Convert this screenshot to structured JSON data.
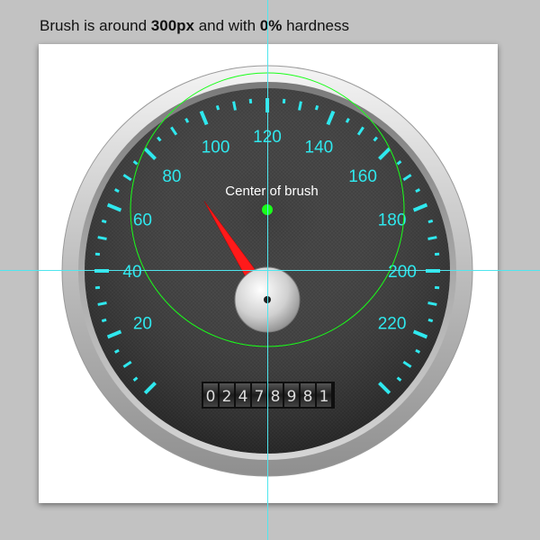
{
  "caption": {
    "prefix": "Brush is around ",
    "size_value": "300px",
    "middle": " and with ",
    "hardness_value": "0%",
    "suffix": " hardness"
  },
  "gauge": {
    "scale_labels": [
      "20",
      "40",
      "60",
      "80",
      "100",
      "120",
      "140",
      "160",
      "180",
      "200",
      "220"
    ],
    "needle_value": 91,
    "brush_center_label": "Center of brush",
    "odometer_digits": [
      "0",
      "2",
      "4",
      "7",
      "8",
      "9",
      "8",
      "1"
    ]
  },
  "colors": {
    "accent_cyan": "#2fe8ee",
    "needle_red": "#ff1a1a",
    "brush_green": "#19ff19",
    "dial_dark": "#2e2e2e",
    "guide_cyan": "#4fe6ee"
  }
}
